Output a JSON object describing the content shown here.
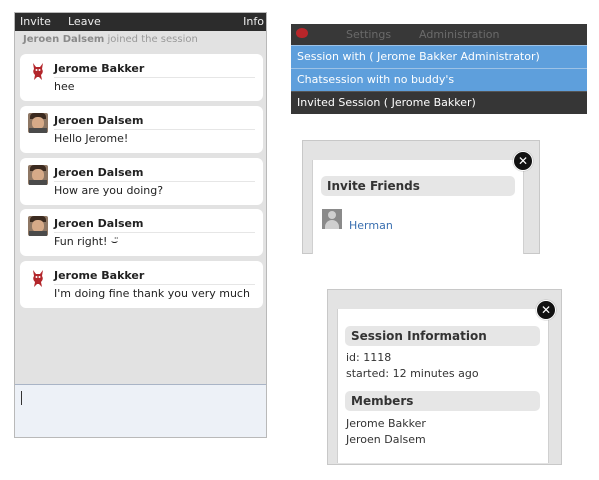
{
  "chat": {
    "toolbar": {
      "invite": "Invite",
      "leave": "Leave",
      "info": "Info"
    },
    "join_notice": {
      "name": "Jeroen Dalsem",
      "suffix": "joined the session"
    },
    "messages": [
      {
        "sender": "Jerome Bakker",
        "text": "hee",
        "avatar": "devil-icon"
      },
      {
        "sender": "Jeroen Dalsem",
        "text": "Hello Jerome!",
        "avatar": "user-photo"
      },
      {
        "sender": "Jeroen Dalsem",
        "text": "How are you doing?",
        "avatar": "user-photo"
      },
      {
        "sender": "Jeroen Dalsem",
        "text": "Fun right! ⌣̈",
        "avatar": "user-photo"
      },
      {
        "sender": "Jerome Bakker",
        "text": "I'm doing fine thank you very much",
        "avatar": "devil-icon"
      }
    ],
    "input": {
      "value": ""
    }
  },
  "menu": {
    "settings": "Settings",
    "administration": "Administration",
    "items": [
      "Session with ( Jerome Bakker Administrator)",
      "Chatsession with no buddy's",
      "Invited Session ( Jerome Bakker)"
    ],
    "accent": "#5e9fdc"
  },
  "invite_dialog": {
    "title": "Invite Friends",
    "friends": [
      "Herman"
    ]
  },
  "session_dialog": {
    "title": "Session Information",
    "id": "id: 1118",
    "started": "started: 12 minutes ago",
    "members_title": "Members",
    "members": [
      "Jerome Bakker",
      "Jeroen Dalsem"
    ]
  }
}
